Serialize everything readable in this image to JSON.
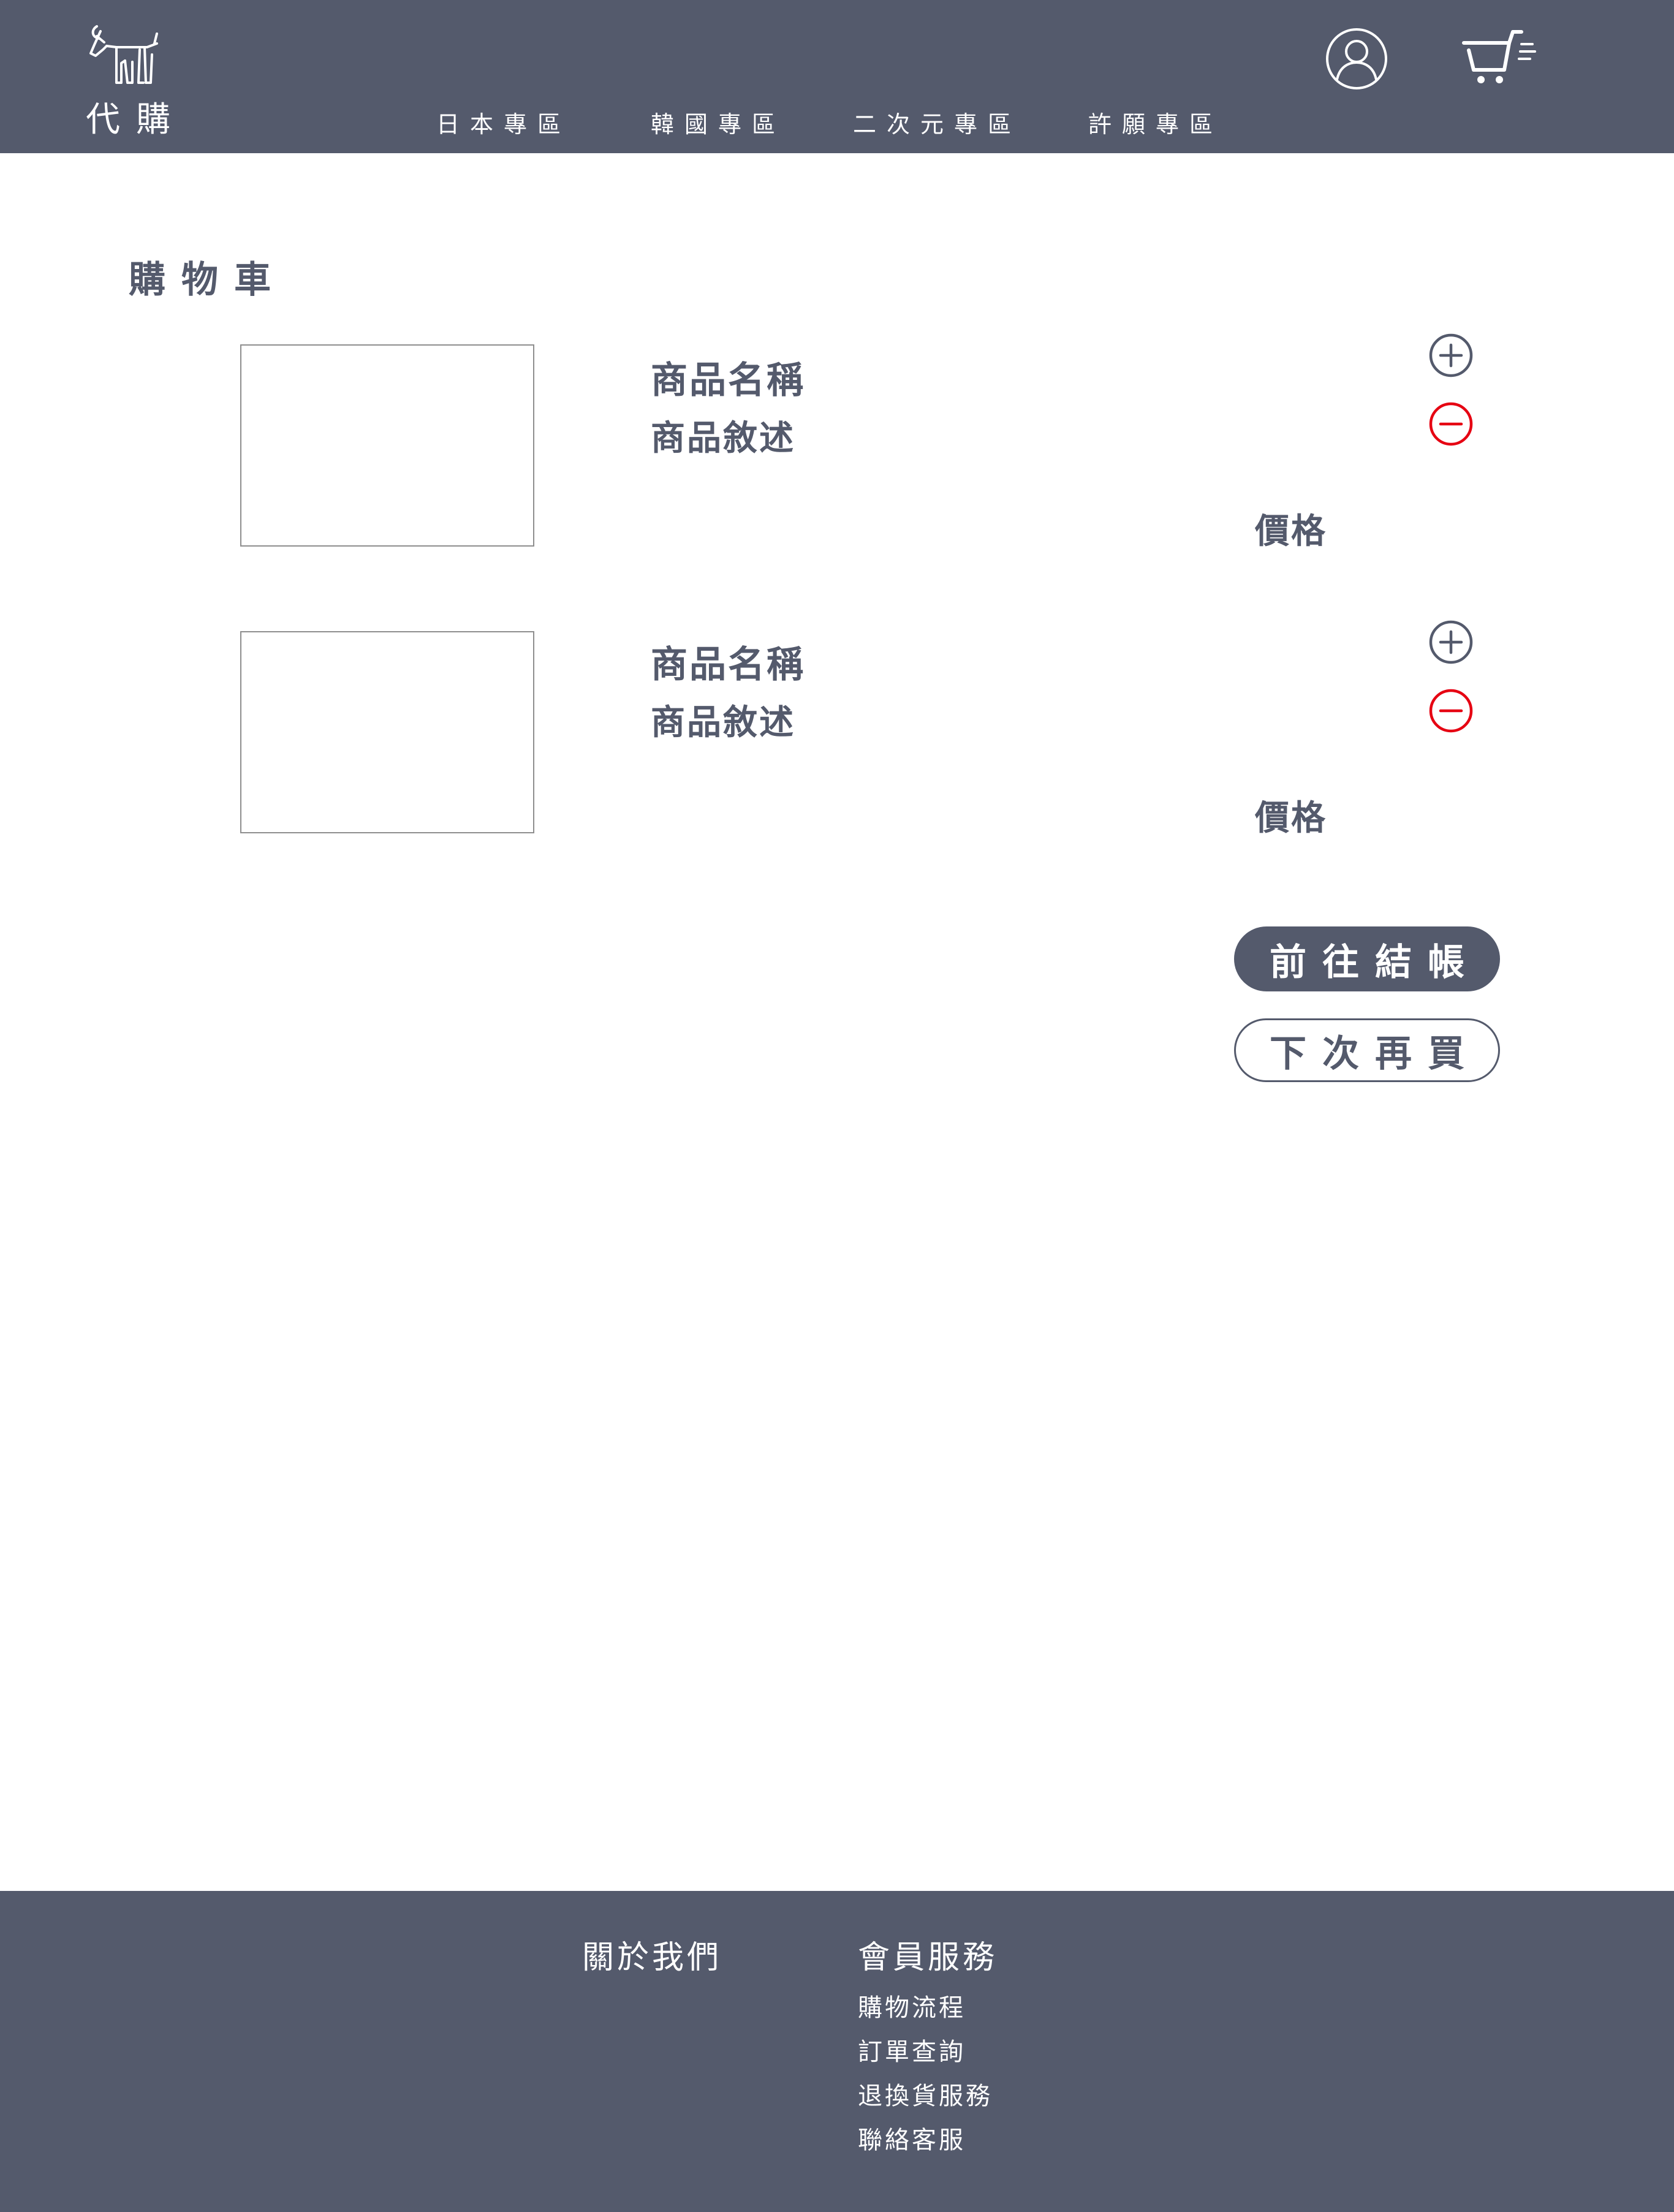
{
  "header": {
    "logo_text": "代購",
    "nav": [
      "日本專區",
      "韓國專區",
      "二次元專區",
      "許願專區"
    ]
  },
  "cart": {
    "title": "購物車",
    "items": [
      {
        "name": "商品名稱",
        "description": "商品敘述",
        "price": "價格"
      },
      {
        "name": "商品名稱",
        "description": "商品敘述",
        "price": "價格"
      }
    ],
    "checkout_label": "前往結帳",
    "later_label": "下次再買"
  },
  "footer": {
    "about_heading": "關於我們",
    "member_heading": "會員服務",
    "member_links": [
      "購物流程",
      "訂單查詢",
      "退換貨服務",
      "聯絡客服"
    ]
  },
  "colors": {
    "primary": "#545a6c",
    "remove": "#e60012",
    "border": "#8e8e8e"
  },
  "icons": [
    "goat-logo",
    "user-icon",
    "cart-icon",
    "plus-circle-icon",
    "minus-circle-icon"
  ]
}
